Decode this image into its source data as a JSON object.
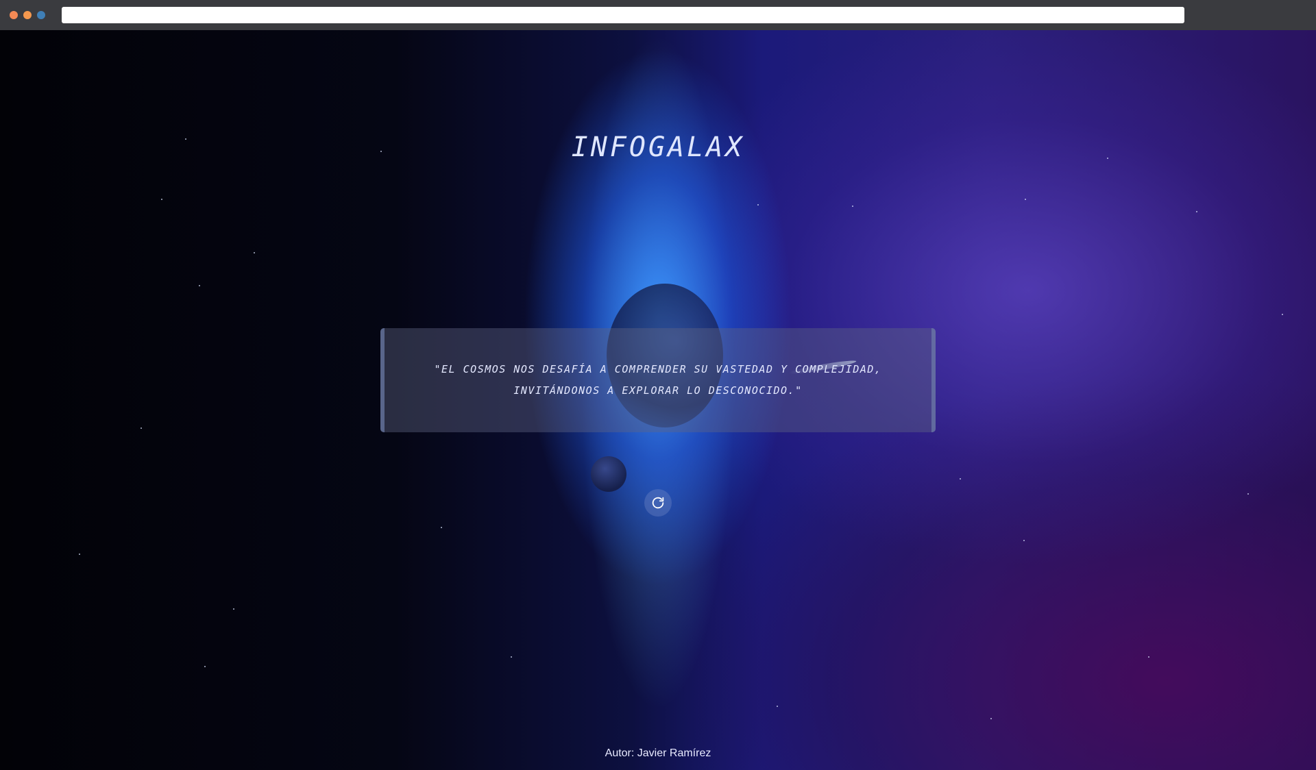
{
  "browser": {
    "address_value": ""
  },
  "page": {
    "title": "INFOGALAX",
    "quote": "\"El cosmos nos desafía a comprender su vastedad y complejidad, invitándonos a explorar lo desconocido.\"",
    "refresh_icon": "refresh-icon",
    "author": "Autor: Javier Ramírez"
  },
  "colors": {
    "title": "#dfe6ff",
    "quote_text": "#e4e8ff",
    "author": "#e8eaff",
    "nebula_blue": "#3c96ff",
    "nebula_purple": "#6e50dc"
  }
}
